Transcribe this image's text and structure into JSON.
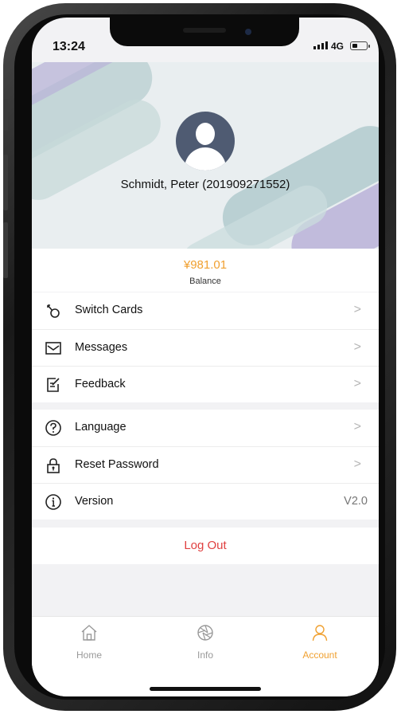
{
  "status_bar": {
    "time": "13:24",
    "network": "4G"
  },
  "profile": {
    "name": "Schmidt, Peter (201909271552)"
  },
  "balance": {
    "amount": "¥981.01",
    "label": "Balance"
  },
  "menu_group_1": [
    {
      "icon": "key-icon",
      "label": "Switch Cards"
    },
    {
      "icon": "envelope-icon",
      "label": "Messages"
    },
    {
      "icon": "feedback-icon",
      "label": "Feedback"
    }
  ],
  "menu_group_2": [
    {
      "icon": "question-icon",
      "label": "Language"
    },
    {
      "icon": "lock-icon",
      "label": "Reset Password"
    },
    {
      "icon": "info-icon",
      "label": "Version",
      "value": "V2.0"
    }
  ],
  "logout_label": "Log Out",
  "tabs": [
    {
      "icon": "home-icon",
      "label": "Home"
    },
    {
      "icon": "aperture-icon",
      "label": "Info"
    },
    {
      "icon": "person-icon",
      "label": "Account",
      "active": true
    }
  ],
  "colors": {
    "accent": "#f0a030",
    "danger": "#e04040",
    "avatar": "#4f5b72"
  }
}
